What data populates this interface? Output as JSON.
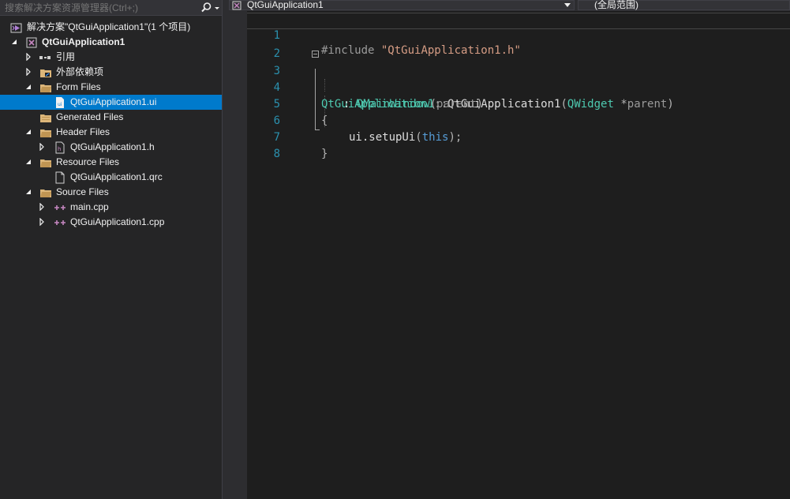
{
  "solution_explorer": {
    "search_placeholder": "搜索解决方案资源管理器(Ctrl+;)",
    "solution_label": "解决方案\"QtGuiApplication1\"(1 个项目)",
    "project_label": "QtGuiApplication1",
    "references_label": "引用",
    "external_deps_label": "外部依赖项",
    "form_files_label": "Form Files",
    "form_file_ui": "QtGuiApplication1.ui",
    "generated_files_label": "Generated Files",
    "header_files_label": "Header Files",
    "header_file_h": "QtGuiApplication1.h",
    "resource_files_label": "Resource Files",
    "resource_file_qrc": "QtGuiApplication1.qrc",
    "source_files_label": "Source Files",
    "source_file_main": "main.cpp",
    "source_file_cpp": "QtGuiApplication1.cpp"
  },
  "editor": {
    "nav_project": "QtGuiApplication1",
    "nav_scope": "(全局范围)",
    "line_numbers": [
      "1",
      "2",
      "3",
      "4",
      "5",
      "6",
      "7",
      "8"
    ],
    "code": {
      "l1_directive": "#include",
      "l1_string": "\"QtGuiApplication1.h\"",
      "l3_class": "QtGuiApplication1",
      "l3_scope": "::",
      "l3_ctor": "QtGuiApplication1",
      "l3_open": "(",
      "l3_type": "QWidget",
      "l3_ptr": " *",
      "l3_param": "parent",
      "l3_close": ")",
      "l4_colon": ": ",
      "l4_base": "QMainWindow",
      "l4_open": "(",
      "l4_arg": "parent",
      "l4_close": ")",
      "l5_brace": "{",
      "l6_obj": "ui.setupUi",
      "l6_open": "(",
      "l6_this": "this",
      "l6_close": ");",
      "l7_brace": "}"
    }
  },
  "colors": {
    "accent_selected": "#007acc",
    "line_number": "#2b91af",
    "type": "#4ec9b0",
    "keyword": "#569cd6",
    "string": "#d69d85"
  },
  "icons": {
    "search": "search-icon",
    "solution": "visual-studio-solution-icon",
    "project": "qt-project-icon",
    "folder": "filter-folder-icon",
    "file": "document-icon",
    "cpp": "cpp-file-icon"
  }
}
